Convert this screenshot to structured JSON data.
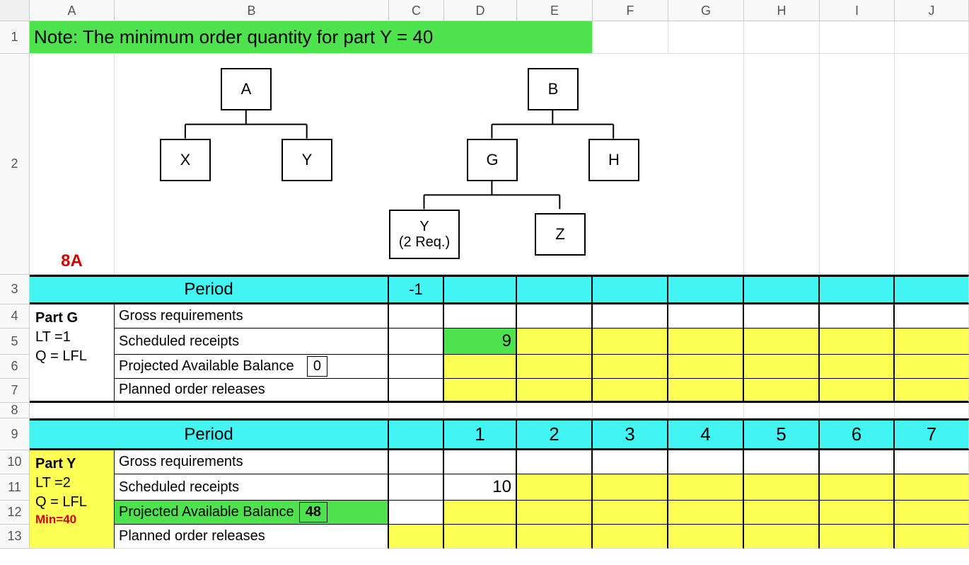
{
  "columns": [
    "A",
    "B",
    "C",
    "D",
    "E",
    "F",
    "G",
    "H",
    "I",
    "J"
  ],
  "rows": [
    "1",
    "2",
    "3",
    "4",
    "5",
    "6",
    "7",
    "8",
    "9",
    "10",
    "11",
    "12",
    "13"
  ],
  "note": "Note: The minimum order quantity for part Y = 40",
  "row2_label": "8A",
  "bom": {
    "left_root": "A",
    "left_children": [
      "X",
      "Y"
    ],
    "right_root": "B",
    "right_children": [
      "G",
      "H"
    ],
    "g_children": [
      "Y\n(2 Req.)",
      "Z"
    ]
  },
  "tableG": {
    "period_label": "Period",
    "neg1": "-1",
    "part": {
      "title": "Part G",
      "lt": "LT =1",
      "q": "Q = LFL"
    },
    "rows": {
      "gross": "Gross requirements",
      "sched": "Scheduled receipts",
      "proj": "Projected Available Balance",
      "proj_init": "0",
      "plan": "Planned order releases"
    },
    "sched_D": "9"
  },
  "tableY": {
    "period_label": "Period",
    "periods": [
      "1",
      "2",
      "3",
      "4",
      "5",
      "6",
      "7"
    ],
    "part": {
      "title": "Part Y",
      "lt": "LT =2",
      "q": "Q = LFL",
      "min": "Min=40"
    },
    "rows": {
      "gross": "Gross requirements",
      "sched": "Scheduled receipts",
      "proj": "Projected Available Balance",
      "proj_init": "48",
      "plan": "Planned order releases"
    },
    "sched_D": "10"
  }
}
